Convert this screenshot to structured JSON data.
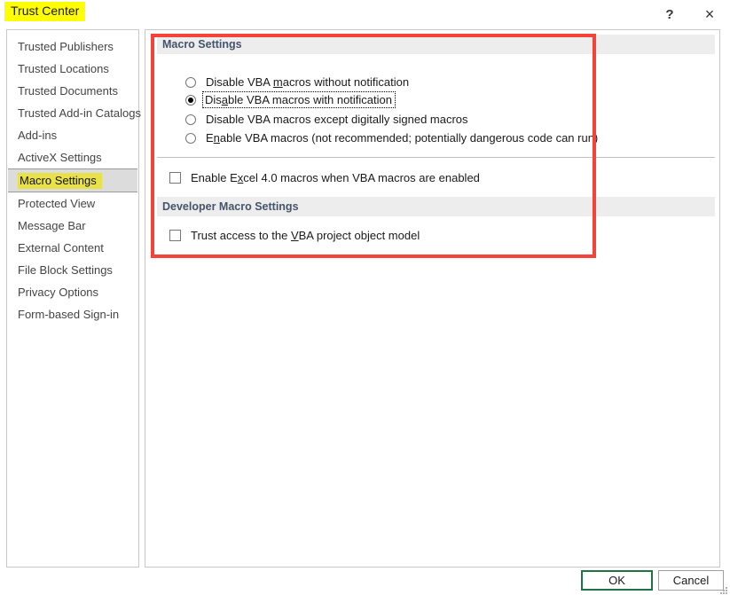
{
  "window": {
    "title": "Trust Center",
    "title_highlight_color": "#FFFF00",
    "help_icon": "?",
    "close_icon": "×"
  },
  "sidebar": {
    "items": [
      {
        "label": "Trusted Publishers",
        "selected": false
      },
      {
        "label": "Trusted Locations",
        "selected": false
      },
      {
        "label": "Trusted Documents",
        "selected": false
      },
      {
        "label": "Trusted Add-in Catalogs",
        "selected": false
      },
      {
        "label": "Add-ins",
        "selected": false
      },
      {
        "label": "ActiveX Settings",
        "selected": false
      },
      {
        "label": "Macro Settings",
        "selected": true
      },
      {
        "label": "Protected View",
        "selected": false
      },
      {
        "label": "Message Bar",
        "selected": false
      },
      {
        "label": "External Content",
        "selected": false
      },
      {
        "label": "File Block Settings",
        "selected": false
      },
      {
        "label": "Privacy Options",
        "selected": false
      },
      {
        "label": "Form-based Sign-in",
        "selected": false
      }
    ],
    "selected_highlight_color": "#E8E14A"
  },
  "main": {
    "sections": [
      {
        "heading": "Macro Settings"
      },
      {
        "heading": "Developer Macro Settings"
      }
    ],
    "macro_settings": {
      "heading": "Macro Settings",
      "radio_group_name": "macro-option",
      "options": [
        {
          "label": "Disable VBA macros without notification",
          "accel_before": "Disable VBA ",
          "accel": "m",
          "accel_after": "acros without notification",
          "checked": false,
          "focused": false
        },
        {
          "label": "Disable VBA macros with notification",
          "accel_before": "Dis",
          "accel": "a",
          "accel_after": "ble VBA macros with notification",
          "checked": true,
          "focused": true
        },
        {
          "label": "Disable VBA macros except digitally signed macros",
          "accel_before": "Disable VBA macros except di",
          "accel": "g",
          "accel_after": "itally signed macros",
          "checked": false,
          "focused": false
        },
        {
          "label": "Enable VBA macros (not recommended; potentially dangerous code can run)",
          "accel_before": "E",
          "accel": "n",
          "accel_after": "able VBA macros (not recommended; potentially dangerous code can run)",
          "checked": false,
          "focused": false
        }
      ],
      "checkbox": {
        "label": "Enable Excel 4.0 macros when VBA macros are enabled",
        "accel_before": "Enable E",
        "accel": "x",
        "accel_after": "cel 4.0 macros when VBA macros are enabled",
        "checked": false
      }
    },
    "developer_macro_settings": {
      "heading": "Developer Macro Settings",
      "checkbox": {
        "label": "Trust access to the VBA project object model",
        "accel_before": "Trust access to the ",
        "accel": "V",
        "accel_after": "BA project object model",
        "checked": false
      }
    }
  },
  "footer": {
    "ok_label": "OK",
    "cancel_label": "Cancel",
    "ok_border_color": "#217346"
  },
  "annotation": {
    "highlight_box_color": "#F4443A"
  }
}
